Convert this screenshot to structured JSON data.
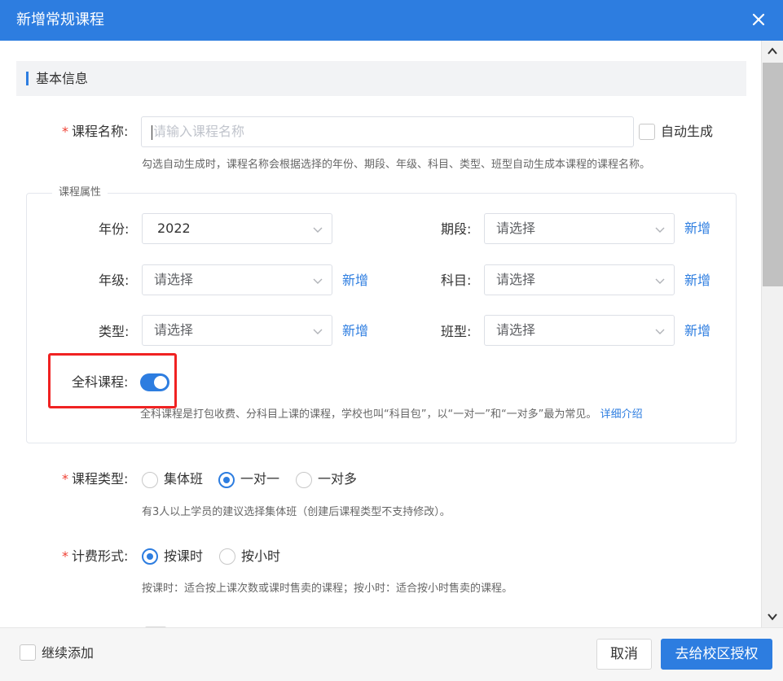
{
  "dialog": {
    "title": "新增常规课程",
    "close_icon": "close-icon"
  },
  "section": {
    "basic_info": "基本信息"
  },
  "course_name": {
    "required_mark": "*",
    "label": "课程名称:",
    "placeholder": "请输入课程名称",
    "value": "",
    "auto_generate_label": "自动生成",
    "auto_generate_checked": false,
    "hint": "勾选自动生成时，课程名称会根据选择的年份、期段、年级、科目、类型、班型自动生成本课程的课程名称。"
  },
  "attributes": {
    "legend": "课程属性",
    "year": {
      "label": "年份:",
      "value": "2022"
    },
    "period": {
      "label": "期段:",
      "value": "请选择",
      "add": "新增"
    },
    "grade": {
      "label": "年级:",
      "value": "请选择",
      "add": "新增"
    },
    "subject": {
      "label": "科目:",
      "value": "请选择",
      "add": "新增"
    },
    "type": {
      "label": "类型:",
      "value": "请选择",
      "add": "新增"
    },
    "class_type": {
      "label": "班型:",
      "value": "请选择",
      "add": "新增"
    },
    "full_subject": {
      "label": "全科课程:",
      "enabled": true,
      "hint": "全科课程是打包收费、分科目上课的课程，学校也叫“科目包”，以“一对一”和“一对多”最为常见。",
      "detail_link": "详细介绍"
    }
  },
  "course_type": {
    "required_mark": "*",
    "label": "课程类型:",
    "options": [
      "集体班",
      "一对一",
      "一对多"
    ],
    "selected": "一对一",
    "hint": "有3人以上学员的建议选择集体班（创建后课程类型不支持修改）。"
  },
  "billing": {
    "required_mark": "*",
    "label": "计费形式:",
    "options": [
      "按课时",
      "按小时"
    ],
    "selected": "按课时",
    "hint": "按课时：适合按上课次数或课时售卖的课程；按小时：适合按小时售卖的课程。"
  },
  "footer": {
    "continue_label": "继续添加",
    "continue_checked": false,
    "cancel": "取消",
    "submit": "去给校区授权"
  },
  "colors": {
    "primary": "#2d7de0",
    "required": "#f04134",
    "highlight_box": "#f02222"
  }
}
